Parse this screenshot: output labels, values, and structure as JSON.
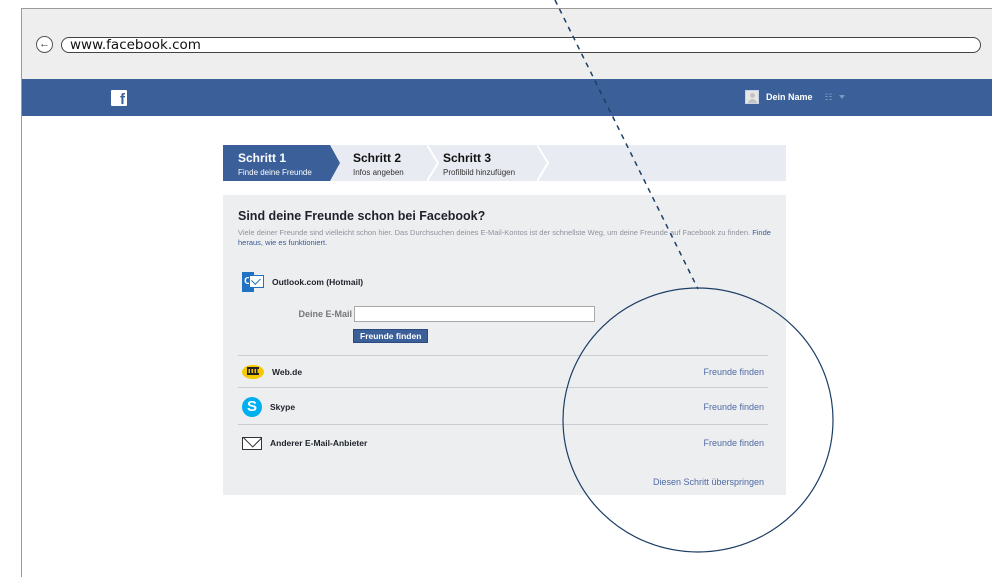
{
  "browser": {
    "url": "www.facebook.com",
    "back_icon": "left-arrow-icon"
  },
  "header": {
    "logo": "f",
    "user_name": "Dein Name",
    "menu_icon": "friends-icon",
    "colors": {
      "brand": "#3b5f98"
    }
  },
  "steps": [
    {
      "title": "Schritt 1",
      "subtitle": "Finde deine Freunde",
      "active": true
    },
    {
      "title": "Schritt 2",
      "subtitle": "Infos angeben",
      "active": false
    },
    {
      "title": "Schritt 3",
      "subtitle": "Profilbild hinzufügen",
      "active": false
    }
  ],
  "panel": {
    "title": "Sind deine Freunde schon bei Facebook?",
    "description": "Viele deiner Freunde sind vielleicht schon hier. Das Durchsuchen deines E-Mail-Kontos ist der schnellste Weg, um deine Freunde auf Facebook zu finden.",
    "help_link": "Finde heraus, wie es funktioniert.",
    "outlook": {
      "name": "Outlook.com (Hotmail)",
      "email_label": "Deine E-Mail",
      "email_value": "",
      "button": "Freunde finden"
    },
    "providers": [
      {
        "name": "Web.de",
        "icon": "webde-icon",
        "link": "Freunde finden"
      },
      {
        "name": "Skype",
        "icon": "skype-icon",
        "link": "Freunde finden"
      },
      {
        "name": "Anderer E-Mail-Anbieter",
        "icon": "mail-icon",
        "link": "Freunde finden"
      }
    ],
    "skip": "Diesen Schritt überspringen"
  }
}
